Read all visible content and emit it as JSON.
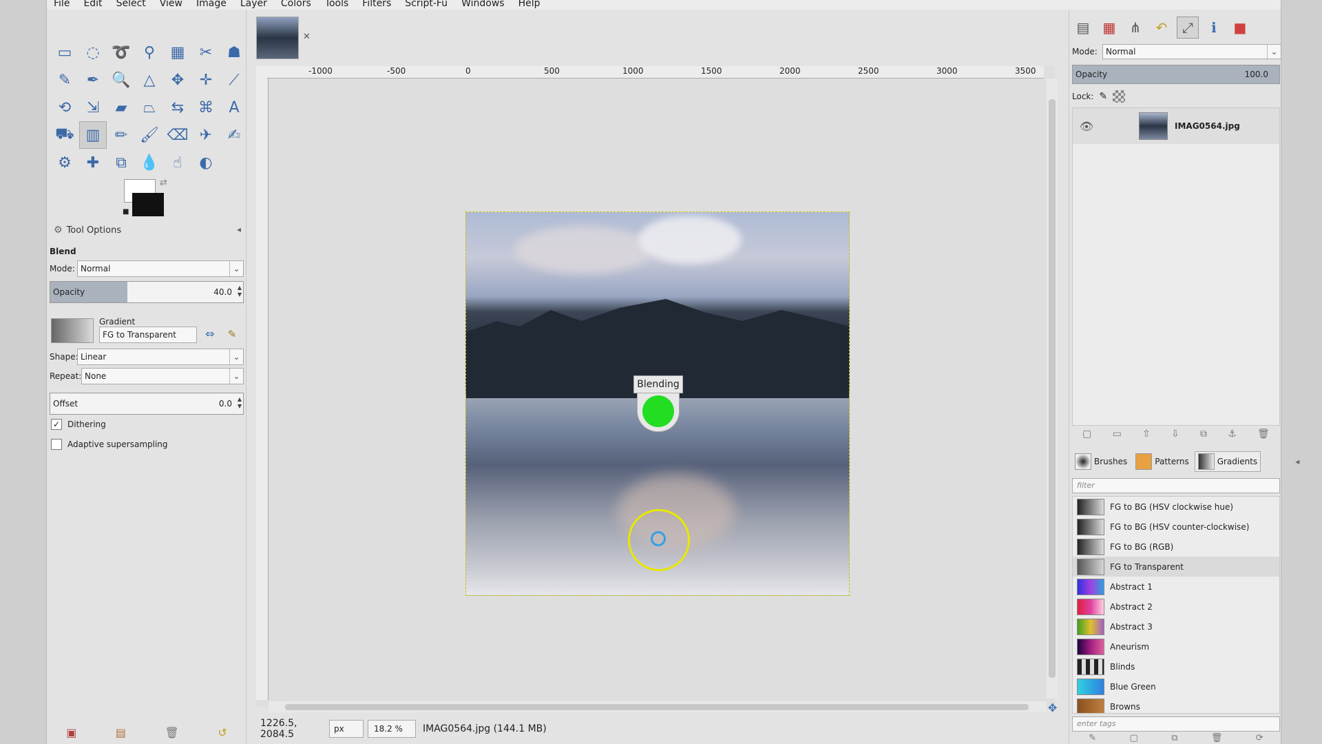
{
  "menu": [
    "File",
    "Edit",
    "Select",
    "View",
    "Image",
    "Layer",
    "Colors",
    "Tools",
    "Filters",
    "Script-Fu",
    "Windows",
    "Help"
  ],
  "tools": [
    {
      "name": "rect-select-icon",
      "glyph": "▭"
    },
    {
      "name": "ellipse-select-icon",
      "glyph": "◌"
    },
    {
      "name": "free-select-icon",
      "glyph": "➰"
    },
    {
      "name": "fuzzy-select-icon",
      "glyph": "⚲"
    },
    {
      "name": "color-select-icon",
      "glyph": "▦"
    },
    {
      "name": "scissors-icon",
      "glyph": "✂"
    },
    {
      "name": "foreground-select-icon",
      "glyph": "☗"
    },
    {
      "name": "paths-icon",
      "glyph": "✎"
    },
    {
      "name": "color-picker-icon",
      "glyph": "✒"
    },
    {
      "name": "zoom-icon",
      "glyph": "🔍"
    },
    {
      "name": "measure-icon",
      "glyph": "△"
    },
    {
      "name": "move-icon",
      "glyph": "✥"
    },
    {
      "name": "align-icon",
      "glyph": "✛"
    },
    {
      "name": "crop-icon",
      "glyph": "⟋"
    },
    {
      "name": "rotate-icon",
      "glyph": "⟲"
    },
    {
      "name": "scale-icon",
      "glyph": "⇲"
    },
    {
      "name": "shear-icon",
      "glyph": "▰"
    },
    {
      "name": "perspective-icon",
      "glyph": "⏢"
    },
    {
      "name": "flip-icon",
      "glyph": "⇆"
    },
    {
      "name": "cage-icon",
      "glyph": "⌘"
    },
    {
      "name": "text-icon",
      "glyph": "A"
    },
    {
      "name": "bucket-fill-icon",
      "glyph": "⛟"
    },
    {
      "name": "blend-icon",
      "glyph": "▥"
    },
    {
      "name": "pencil-icon",
      "glyph": "✏"
    },
    {
      "name": "paintbrush-icon",
      "glyph": "🖌"
    },
    {
      "name": "eraser-icon",
      "glyph": "⌫"
    },
    {
      "name": "airbrush-icon",
      "glyph": "✈"
    },
    {
      "name": "ink-icon",
      "glyph": "✍"
    },
    {
      "name": "clone-icon",
      "glyph": "⚙"
    },
    {
      "name": "heal-icon",
      "glyph": "✚"
    },
    {
      "name": "perspective-clone-icon",
      "glyph": "⧉"
    },
    {
      "name": "blur-icon",
      "glyph": "💧"
    },
    {
      "name": "smudge-icon",
      "glyph": "☝"
    },
    {
      "name": "dodge-burn-icon",
      "glyph": "◐"
    }
  ],
  "selected_tool": "blend-icon",
  "tool_options": {
    "tab_label": "Tool Options",
    "title": "Blend",
    "mode_label": "Mode:",
    "mode_value": "Normal",
    "opacity_label": "Opacity",
    "opacity_value": "40.0",
    "opacity_fraction": 0.4,
    "gradient_label": "Gradient",
    "gradient_value": "FG to Transparent",
    "shape_label": "Shape:",
    "shape_value": "Linear",
    "repeat_label": "Repeat:",
    "repeat_value": "None",
    "offset_label": "Offset",
    "offset_value": "0.0",
    "dithering_label": "Dithering",
    "dithering_checked": true,
    "adaptive_label": "Adaptive supersampling",
    "adaptive_checked": false
  },
  "ruler_ticks": [
    "-1000",
    "-500",
    "0",
    "500",
    "1000",
    "1500",
    "2000",
    "2500",
    "3000",
    "3500"
  ],
  "blend_label": "Blending",
  "status": {
    "coords": "1226.5, 2084.5",
    "unit": "px",
    "zoom": "18.2 %",
    "info": "IMAG0564.jpg (144.1 MB)"
  },
  "layers": {
    "mode_label": "Mode:",
    "mode_value": "Normal",
    "opacity_label": "Opacity",
    "opacity_value": "100.0",
    "lock_label": "Lock:",
    "items": [
      {
        "name": "IMAG0564.jpg"
      }
    ]
  },
  "resource_tabs": [
    {
      "label": "Brushes",
      "color": "#888888"
    },
    {
      "label": "Patterns",
      "color": "#e8a040"
    },
    {
      "label": "Gradients",
      "color": "#999999"
    }
  ],
  "filter_placeholder": "filter",
  "tags_placeholder": "enter tags",
  "gradients": [
    {
      "name": "FG to BG (HSV clockwise hue)",
      "css": "linear-gradient(90deg,#222,#ddd)"
    },
    {
      "name": "FG to BG (HSV counter-clockwise)",
      "css": "linear-gradient(90deg,#222,#ddd)"
    },
    {
      "name": "FG to BG (RGB)",
      "css": "linear-gradient(90deg,#222,#ddd)"
    },
    {
      "name": "FG to Transparent",
      "css": "linear-gradient(90deg,#555,rgba(200,200,200,0.2))",
      "selected": true
    },
    {
      "name": "Abstract 1",
      "css": "linear-gradient(90deg,#3030e0,#a040e0,#30a0e0)"
    },
    {
      "name": "Abstract 2",
      "css": "linear-gradient(90deg,#e02040,#e040a0,#ffd0e0)"
    },
    {
      "name": "Abstract 3",
      "css": "linear-gradient(90deg,#40a020,#e0c030,#a060c0)"
    },
    {
      "name": "Aneurism",
      "css": "linear-gradient(90deg,#200040,#a02080,#e060a0)"
    },
    {
      "name": "Blinds",
      "css": "repeating-linear-gradient(90deg,#222 0 6px,#ddd 6px 12px)"
    },
    {
      "name": "Blue Green",
      "css": "linear-gradient(90deg,#30d0e0,#3080e0)"
    },
    {
      "name": "Browns",
      "css": "linear-gradient(90deg,#8a5020,#c08040)"
    }
  ]
}
